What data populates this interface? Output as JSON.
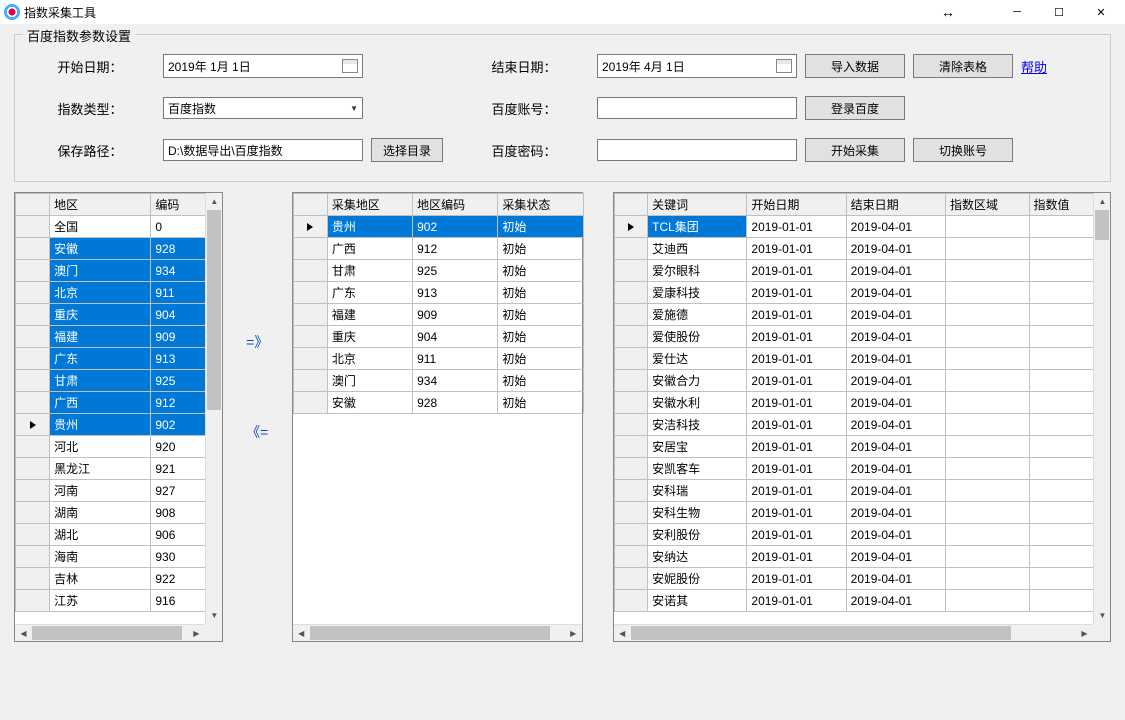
{
  "window": {
    "title": "指数采集工具"
  },
  "fieldset": {
    "legend": "百度指数参数设置"
  },
  "form": {
    "start_date_label": "开始日期：",
    "start_date_value": "2019年 1月 1日",
    "end_date_label": "结束日期：",
    "end_date_value": "2019年 4月 1日",
    "import_btn": "导入数据",
    "clear_btn": "清除表格",
    "help_link": "帮助",
    "index_type_label": "指数类型：",
    "index_type_value": "百度指数",
    "account_label": "百度账号：",
    "login_btn": "登录百度",
    "save_path_label": "保存路径：",
    "save_path_value": "D:\\数据导出\\百度指数",
    "choose_dir_btn": "选择目录",
    "password_label": "百度密码：",
    "start_collect_btn": "开始采集",
    "switch_account_btn": "切换账号"
  },
  "transfer": {
    "add": "=》",
    "remove": "《="
  },
  "grid1": {
    "headers": [
      "地区",
      "编码"
    ],
    "rows": [
      {
        "region": "全国",
        "code": "0",
        "sel": false
      },
      {
        "region": "安徽",
        "code": "928",
        "sel": true
      },
      {
        "region": "澳门",
        "code": "934",
        "sel": true
      },
      {
        "region": "北京",
        "code": "911",
        "sel": true
      },
      {
        "region": "重庆",
        "code": "904",
        "sel": true
      },
      {
        "region": "福建",
        "code": "909",
        "sel": true
      },
      {
        "region": "广东",
        "code": "913",
        "sel": true
      },
      {
        "region": "甘肃",
        "code": "925",
        "sel": true
      },
      {
        "region": "广西",
        "code": "912",
        "sel": true
      },
      {
        "region": "贵州",
        "code": "902",
        "sel": true,
        "current": true
      },
      {
        "region": "河北",
        "code": "920",
        "sel": false
      },
      {
        "region": "黑龙江",
        "code": "921",
        "sel": false
      },
      {
        "region": "河南",
        "code": "927",
        "sel": false
      },
      {
        "region": "湖南",
        "code": "908",
        "sel": false
      },
      {
        "region": "湖北",
        "code": "906",
        "sel": false
      },
      {
        "region": "海南",
        "code": "930",
        "sel": false
      },
      {
        "region": "吉林",
        "code": "922",
        "sel": false
      },
      {
        "region": "江苏",
        "code": "916",
        "sel": false
      }
    ]
  },
  "grid2": {
    "headers": [
      "采集地区",
      "地区编码",
      "采集状态"
    ],
    "rows": [
      {
        "region": "贵州",
        "code": "902",
        "status": "初始",
        "current": true
      },
      {
        "region": "广西",
        "code": "912",
        "status": "初始"
      },
      {
        "region": "甘肃",
        "code": "925",
        "status": "初始"
      },
      {
        "region": "广东",
        "code": "913",
        "status": "初始"
      },
      {
        "region": "福建",
        "code": "909",
        "status": "初始"
      },
      {
        "region": "重庆",
        "code": "904",
        "status": "初始"
      },
      {
        "region": "北京",
        "code": "911",
        "status": "初始"
      },
      {
        "region": "澳门",
        "code": "934",
        "status": "初始"
      },
      {
        "region": "安徽",
        "code": "928",
        "status": "初始"
      }
    ]
  },
  "grid3": {
    "headers": [
      "关键词",
      "开始日期",
      "结束日期",
      "指数区域",
      "指数值"
    ],
    "rows": [
      {
        "kw": "TCL集团",
        "start": "2019-01-01",
        "end": "2019-04-01",
        "region": "",
        "val": "",
        "current": true
      },
      {
        "kw": "艾迪西",
        "start": "2019-01-01",
        "end": "2019-04-01",
        "region": "",
        "val": ""
      },
      {
        "kw": "爱尔眼科",
        "start": "2019-01-01",
        "end": "2019-04-01",
        "region": "",
        "val": ""
      },
      {
        "kw": "爱康科技",
        "start": "2019-01-01",
        "end": "2019-04-01",
        "region": "",
        "val": ""
      },
      {
        "kw": "爱施德",
        "start": "2019-01-01",
        "end": "2019-04-01",
        "region": "",
        "val": ""
      },
      {
        "kw": "爱使股份",
        "start": "2019-01-01",
        "end": "2019-04-01",
        "region": "",
        "val": ""
      },
      {
        "kw": "爱仕达",
        "start": "2019-01-01",
        "end": "2019-04-01",
        "region": "",
        "val": ""
      },
      {
        "kw": "安徽合力",
        "start": "2019-01-01",
        "end": "2019-04-01",
        "region": "",
        "val": ""
      },
      {
        "kw": "安徽水利",
        "start": "2019-01-01",
        "end": "2019-04-01",
        "region": "",
        "val": ""
      },
      {
        "kw": "安洁科技",
        "start": "2019-01-01",
        "end": "2019-04-01",
        "region": "",
        "val": ""
      },
      {
        "kw": "安居宝",
        "start": "2019-01-01",
        "end": "2019-04-01",
        "region": "",
        "val": ""
      },
      {
        "kw": "安凯客车",
        "start": "2019-01-01",
        "end": "2019-04-01",
        "region": "",
        "val": ""
      },
      {
        "kw": "安科瑞",
        "start": "2019-01-01",
        "end": "2019-04-01",
        "region": "",
        "val": ""
      },
      {
        "kw": "安科生物",
        "start": "2019-01-01",
        "end": "2019-04-01",
        "region": "",
        "val": ""
      },
      {
        "kw": "安利股份",
        "start": "2019-01-01",
        "end": "2019-04-01",
        "region": "",
        "val": ""
      },
      {
        "kw": "安纳达",
        "start": "2019-01-01",
        "end": "2019-04-01",
        "region": "",
        "val": ""
      },
      {
        "kw": "安妮股份",
        "start": "2019-01-01",
        "end": "2019-04-01",
        "region": "",
        "val": ""
      },
      {
        "kw": "安诺其",
        "start": "2019-01-01",
        "end": "2019-04-01",
        "region": "",
        "val": ""
      }
    ]
  }
}
